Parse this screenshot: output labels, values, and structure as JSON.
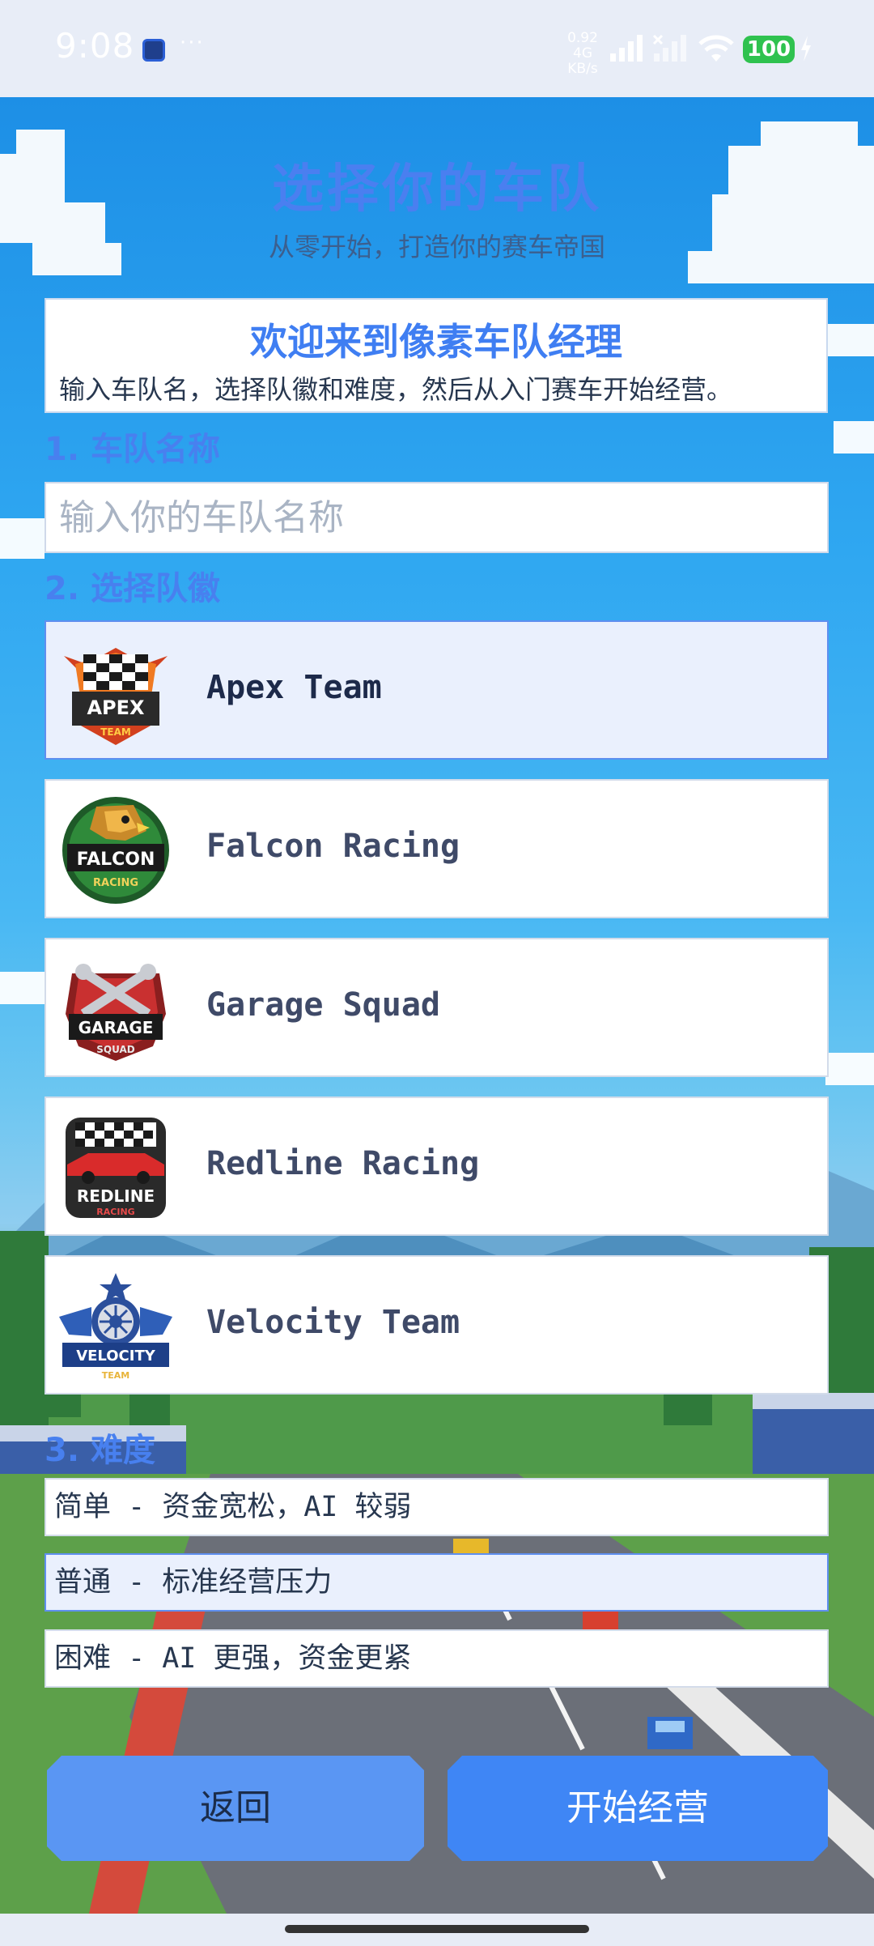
{
  "status_bar": {
    "time": "9:08",
    "more": "···",
    "net_speed_value": "0.92 4G",
    "net_speed_unit": "KB/s",
    "battery": "100",
    "icons": [
      "app-notification-icon",
      "signal-icon",
      "signal-no-service-icon",
      "wifi-icon",
      "battery-icon",
      "charging-icon"
    ]
  },
  "header": {
    "title": "选择你的车队",
    "subtitle": "从零开始，打造你的赛车帝国"
  },
  "welcome": {
    "title": "欢迎来到像素车队经理",
    "text": "输入车队名，选择队徽和难度，然后从入门赛车开始经营。"
  },
  "sections": {
    "team_name": "1. 车队名称",
    "emblem": "2. 选择队徽",
    "difficulty": "3. 难度"
  },
  "team_name_input": {
    "placeholder": "输入你的车队名称",
    "value": ""
  },
  "teams": [
    {
      "name": "Apex Team",
      "logo": "apex-logo-icon",
      "logo_text": "APEX",
      "logo_sub": "TEAM",
      "selected": true
    },
    {
      "name": "Falcon Racing",
      "logo": "falcon-logo-icon",
      "logo_text": "FALCON",
      "logo_sub": "RACING",
      "selected": false
    },
    {
      "name": "Garage Squad",
      "logo": "garage-logo-icon",
      "logo_text": "GARAGE",
      "logo_sub": "SQUAD",
      "selected": false
    },
    {
      "name": "Redline Racing",
      "logo": "redline-logo-icon",
      "logo_text": "REDLINE",
      "logo_sub": "RACING",
      "selected": false
    },
    {
      "name": "Velocity Team",
      "logo": "velocity-logo-icon",
      "logo_text": "VELOCITY",
      "logo_sub": "TEAM",
      "selected": false
    }
  ],
  "difficulties": [
    {
      "label": "简单 - 资金宽松，AI 较弱",
      "selected": false
    },
    {
      "label": "普通 - 标准经营压力",
      "selected": true
    },
    {
      "label": "困难 - AI 更强，资金更紧",
      "selected": false
    }
  ],
  "buttons": {
    "back": "返回",
    "start": "开始经营"
  },
  "colors": {
    "accent": "#3f86f5",
    "title": "#4a7ff0",
    "selected_bg": "#eaf0fd",
    "battery": "#2fc24f"
  }
}
